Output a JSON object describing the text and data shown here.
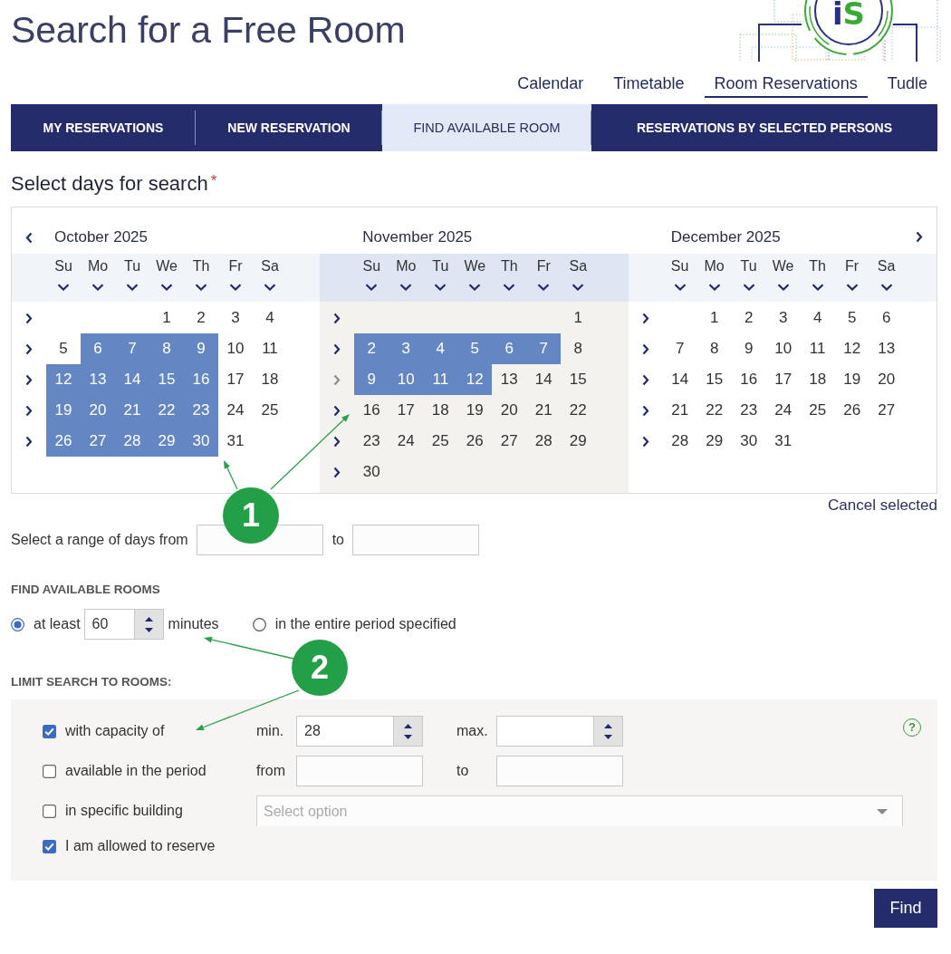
{
  "page": {
    "title": "Search for a Free Room",
    "logo_text": "iS"
  },
  "nav_links": [
    {
      "label": "Calendar",
      "selected": false
    },
    {
      "label": "Timetable",
      "selected": false
    },
    {
      "label": "Room Reservations",
      "selected": true
    },
    {
      "label": "Tudle",
      "selected": false
    }
  ],
  "tabs": [
    {
      "label": "MY RESERVATIONS",
      "selected": false
    },
    {
      "label": "NEW RESERVATION",
      "selected": false
    },
    {
      "label": "FIND AVAILABLE ROOM",
      "selected": true
    },
    {
      "label": "RESERVATIONS BY SELECTED PERSONS",
      "selected": false
    }
  ],
  "day_picker": {
    "heading": "Select days for search",
    "required_mark": "*",
    "cancel_link": "Cancel selected",
    "months": [
      {
        "title": "October 2025",
        "current": false,
        "weekdays": [
          "Su",
          "Mo",
          "Tu",
          "We",
          "Th",
          "Fr",
          "Sa"
        ],
        "weeks": [
          {
            "dimmed": false,
            "days": [
              {
                "label": "1",
                "selected": false
              },
              {
                "label": "2",
                "selected": false
              },
              {
                "label": "3",
                "selected": false
              },
              {
                "label": "4",
                "selected": false
              }
            ]
          },
          {
            "dimmed": false,
            "days": [
              {
                "label": "5",
                "selected": false
              },
              {
                "label": "6",
                "selected": true
              },
              {
                "label": "7",
                "selected": true
              },
              {
                "label": "8",
                "selected": true
              },
              {
                "label": "9",
                "selected": true
              },
              {
                "label": "10",
                "selected": false
              },
              {
                "label": "11",
                "selected": false
              }
            ]
          },
          {
            "dimmed": false,
            "days": [
              {
                "label": "12",
                "selected": true
              },
              {
                "label": "13",
                "selected": true
              },
              {
                "label": "14",
                "selected": true
              },
              {
                "label": "15",
                "selected": true
              },
              {
                "label": "16",
                "selected": true
              },
              {
                "label": "17",
                "selected": false
              },
              {
                "label": "18",
                "selected": false
              }
            ]
          },
          {
            "dimmed": false,
            "days": [
              {
                "label": "19",
                "selected": true
              },
              {
                "label": "20",
                "selected": true
              },
              {
                "label": "21",
                "selected": true
              },
              {
                "label": "22",
                "selected": true
              },
              {
                "label": "23",
                "selected": true
              },
              {
                "label": "24",
                "selected": false
              },
              {
                "label": "25",
                "selected": false
              }
            ]
          },
          {
            "dimmed": false,
            "days": [
              {
                "label": "26",
                "selected": true
              },
              {
                "label": "27",
                "selected": true
              },
              {
                "label": "28",
                "selected": true
              },
              {
                "label": "29",
                "selected": true
              },
              {
                "label": "30",
                "selected": true
              },
              {
                "label": "31",
                "selected": false
              }
            ]
          }
        ]
      },
      {
        "title": "November 2025",
        "current": true,
        "weekdays": [
          "Su",
          "Mo",
          "Tu",
          "We",
          "Th",
          "Fr",
          "Sa"
        ],
        "weeks": [
          {
            "dimmed": false,
            "days": [
              {
                "label": "1",
                "selected": false
              }
            ]
          },
          {
            "dimmed": false,
            "days": [
              {
                "label": "2",
                "selected": true
              },
              {
                "label": "3",
                "selected": true
              },
              {
                "label": "4",
                "selected": true
              },
              {
                "label": "5",
                "selected": true
              },
              {
                "label": "6",
                "selected": true
              },
              {
                "label": "7",
                "selected": true
              },
              {
                "label": "8",
                "selected": false
              }
            ]
          },
          {
            "dimmed": true,
            "days": [
              {
                "label": "9",
                "selected": true
              },
              {
                "label": "10",
                "selected": true
              },
              {
                "label": "11",
                "selected": true
              },
              {
                "label": "12",
                "selected": true
              },
              {
                "label": "13",
                "selected": false
              },
              {
                "label": "14",
                "selected": false
              },
              {
                "label": "15",
                "selected": false
              }
            ]
          },
          {
            "dimmed": false,
            "days": [
              {
                "label": "16",
                "selected": false
              },
              {
                "label": "17",
                "selected": false
              },
              {
                "label": "18",
                "selected": false
              },
              {
                "label": "19",
                "selected": false
              },
              {
                "label": "20",
                "selected": false
              },
              {
                "label": "21",
                "selected": false
              },
              {
                "label": "22",
                "selected": false
              }
            ]
          },
          {
            "dimmed": false,
            "days": [
              {
                "label": "23",
                "selected": false
              },
              {
                "label": "24",
                "selected": false
              },
              {
                "label": "25",
                "selected": false
              },
              {
                "label": "26",
                "selected": false
              },
              {
                "label": "27",
                "selected": false
              },
              {
                "label": "28",
                "selected": false
              },
              {
                "label": "29",
                "selected": false
              }
            ]
          },
          {
            "dimmed": false,
            "days": [
              {
                "label": "30",
                "selected": false
              }
            ]
          }
        ]
      },
      {
        "title": "December 2025",
        "current": false,
        "weekdays": [
          "Su",
          "Mo",
          "Tu",
          "We",
          "Th",
          "Fr",
          "Sa"
        ],
        "weeks": [
          {
            "dimmed": false,
            "days": [
              {
                "label": "1",
                "selected": false
              },
              {
                "label": "2",
                "selected": false
              },
              {
                "label": "3",
                "selected": false
              },
              {
                "label": "4",
                "selected": false
              },
              {
                "label": "5",
                "selected": false
              },
              {
                "label": "6",
                "selected": false
              }
            ]
          },
          {
            "dimmed": false,
            "days": [
              {
                "label": "7",
                "selected": false
              },
              {
                "label": "8",
                "selected": false
              },
              {
                "label": "9",
                "selected": false
              },
              {
                "label": "10",
                "selected": false
              },
              {
                "label": "11",
                "selected": false
              },
              {
                "label": "12",
                "selected": false
              },
              {
                "label": "13",
                "selected": false
              }
            ]
          },
          {
            "dimmed": false,
            "days": [
              {
                "label": "14",
                "selected": false
              },
              {
                "label": "15",
                "selected": false
              },
              {
                "label": "16",
                "selected": false
              },
              {
                "label": "17",
                "selected": false
              },
              {
                "label": "18",
                "selected": false
              },
              {
                "label": "19",
                "selected": false
              },
              {
                "label": "20",
                "selected": false
              }
            ]
          },
          {
            "dimmed": false,
            "days": [
              {
                "label": "21",
                "selected": false
              },
              {
                "label": "22",
                "selected": false
              },
              {
                "label": "23",
                "selected": false
              },
              {
                "label": "24",
                "selected": false
              },
              {
                "label": "25",
                "selected": false
              },
              {
                "label": "26",
                "selected": false
              },
              {
                "label": "27",
                "selected": false
              }
            ]
          },
          {
            "dimmed": false,
            "days": [
              {
                "label": "28",
                "selected": false
              },
              {
                "label": "29",
                "selected": false
              },
              {
                "label": "30",
                "selected": false
              },
              {
                "label": "31",
                "selected": false
              }
            ]
          }
        ]
      }
    ]
  },
  "range": {
    "label": "Select a range of days from",
    "to_label": "to"
  },
  "find_rooms": {
    "heading": "FIND AVAILABLE ROOMS",
    "options": [
      {
        "kind": "duration",
        "label": "at least",
        "value": "60",
        "unit": "minutes",
        "selected": true
      },
      {
        "kind": "plain",
        "label": "in the entire period specified",
        "selected": false
      }
    ]
  },
  "limits": {
    "heading": "LIMIT SEARCH TO ROOMS:",
    "help_mark": "?",
    "rows": [
      {
        "kind": "spin-range",
        "label": "with capacity of",
        "checked": true,
        "from_label": "min.",
        "from_value": "28",
        "to_label": "max."
      },
      {
        "kind": "text-range",
        "label": "available in the period",
        "checked": false,
        "from_label": "from",
        "to_label": "to"
      },
      {
        "kind": "select",
        "label": "in specific building",
        "checked": false,
        "placeholder": "Select option"
      },
      {
        "kind": "plain",
        "label": "I am allowed to reserve",
        "checked": true
      }
    ]
  },
  "find_button": {
    "label": "Find"
  },
  "callouts": [
    {
      "label": "1"
    },
    {
      "label": "2"
    }
  ]
}
